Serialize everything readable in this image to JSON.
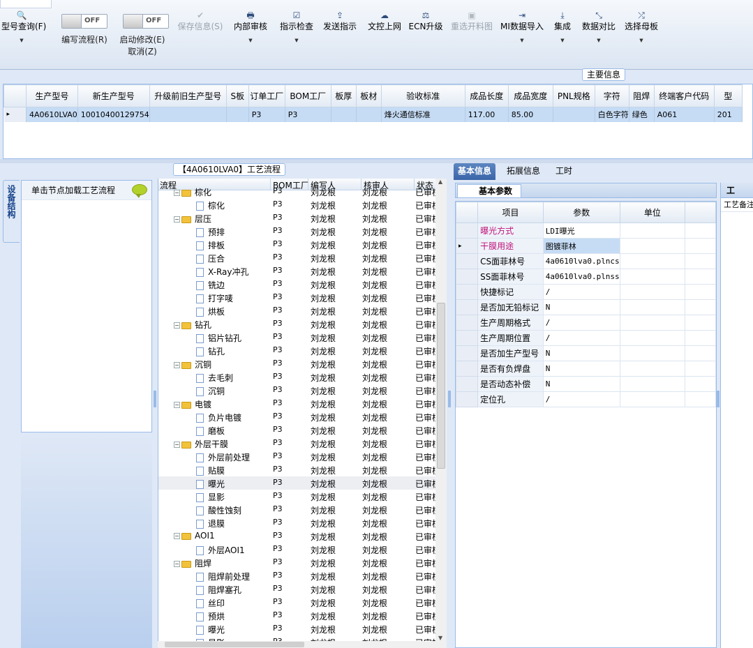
{
  "toolbar": {
    "items": [
      {
        "label": "型号查询(F)",
        "icon": "🔍",
        "dd": "▼",
        "disabled": false
      },
      {
        "label": "保存信息(S)",
        "icon": "✔",
        "dd": "",
        "disabled": true
      },
      {
        "label": "内部审核",
        "icon": "🖶",
        "dd": "▼",
        "disabled": false
      },
      {
        "label": "指示检查",
        "icon": "☑",
        "dd": "▼",
        "disabled": false
      },
      {
        "label": "发送指示",
        "icon": "⇪",
        "dd": "",
        "disabled": false
      },
      {
        "label": "文控上网",
        "icon": "☁",
        "dd": "",
        "disabled": false
      },
      {
        "label": "ECN升级",
        "icon": "⚖",
        "dd": "",
        "disabled": false
      },
      {
        "label": "重选开料图",
        "icon": "▣",
        "dd": "",
        "disabled": true
      },
      {
        "label": "MI数据导入",
        "icon": "⇥",
        "dd": "▼",
        "disabled": false
      },
      {
        "label": "集成",
        "icon": "⤓",
        "dd": "▼",
        "disabled": false
      },
      {
        "label": "数据对比",
        "icon": "⤡",
        "dd": "▼",
        "disabled": false
      },
      {
        "label": "选择母板",
        "icon": "⤮",
        "dd": "▼",
        "disabled": false
      }
    ],
    "toggle1": {
      "state": "OFF",
      "label": "编写流程(R)"
    },
    "toggle2": {
      "state": "OFF",
      "label": "启动修改(E)",
      "label2": "取消(Z)"
    }
  },
  "master": {
    "title": "主要信息",
    "columns": [
      "生产型号",
      "新生产型号",
      "升级前旧生产型号",
      "S板",
      "订单工厂",
      "BOM工厂",
      "板厚",
      "板材",
      "验收标准",
      "成品长度",
      "成品宽度",
      "PNL规格",
      "字符",
      "阻焊",
      "终端客户代码",
      "型"
    ],
    "row": [
      "4A0610LVA0",
      "10010400129754",
      "",
      "",
      "P3",
      "P3",
      "",
      "",
      "烽火通信标准",
      "117.00",
      "85.00",
      "",
      "白色字符",
      "绿色",
      "A061",
      "201"
    ]
  },
  "sidebar": {
    "label": "设备结构"
  },
  "left": {
    "hint": "单击节点加载工艺流程"
  },
  "flow": {
    "title": "【4A0610LVA0】工艺流程",
    "columns": [
      "流程",
      "BOM工厂",
      "编写人",
      "核审人",
      "状态"
    ],
    "rows": [
      {
        "name": "棕化",
        "type": "folder",
        "bom": "P3",
        "w": "刘龙根",
        "r": "刘龙根",
        "s": "已审核"
      },
      {
        "name": "棕化",
        "type": "file",
        "bom": "P3",
        "w": "刘龙根",
        "r": "刘龙根",
        "s": "已审核"
      },
      {
        "name": "层压",
        "type": "folder",
        "bom": "P3",
        "w": "刘龙根",
        "r": "刘龙根",
        "s": "已审核"
      },
      {
        "name": "预排",
        "type": "file",
        "bom": "P3",
        "w": "刘龙根",
        "r": "刘龙根",
        "s": "已审核"
      },
      {
        "name": "排板",
        "type": "file",
        "bom": "P3",
        "w": "刘龙根",
        "r": "刘龙根",
        "s": "已审核"
      },
      {
        "name": "压合",
        "type": "file",
        "bom": "P3",
        "w": "刘龙根",
        "r": "刘龙根",
        "s": "已审核"
      },
      {
        "name": "X-Ray冲孔",
        "type": "file",
        "bom": "P3",
        "w": "刘龙根",
        "r": "刘龙根",
        "s": "已审核"
      },
      {
        "name": "铣边",
        "type": "file",
        "bom": "P3",
        "w": "刘龙根",
        "r": "刘龙根",
        "s": "已审核"
      },
      {
        "name": "打字唛",
        "type": "file",
        "bom": "P3",
        "w": "刘龙根",
        "r": "刘龙根",
        "s": "已审核"
      },
      {
        "name": "烘板",
        "type": "file",
        "bom": "P3",
        "w": "刘龙根",
        "r": "刘龙根",
        "s": "已审核"
      },
      {
        "name": "钻孔",
        "type": "folder",
        "bom": "P3",
        "w": "刘龙根",
        "r": "刘龙根",
        "s": "已审核"
      },
      {
        "name": "铝片钻孔",
        "type": "file",
        "bom": "P3",
        "w": "刘龙根",
        "r": "刘龙根",
        "s": "已审核"
      },
      {
        "name": "钻孔",
        "type": "file",
        "bom": "P3",
        "w": "刘龙根",
        "r": "刘龙根",
        "s": "已审核"
      },
      {
        "name": "沉铜",
        "type": "folder",
        "bom": "P3",
        "w": "刘龙根",
        "r": "刘龙根",
        "s": "已审核"
      },
      {
        "name": "去毛刺",
        "type": "file",
        "bom": "P3",
        "w": "刘龙根",
        "r": "刘龙根",
        "s": "已审核"
      },
      {
        "name": "沉铜",
        "type": "file",
        "bom": "P3",
        "w": "刘龙根",
        "r": "刘龙根",
        "s": "已审核"
      },
      {
        "name": "电镀",
        "type": "folder",
        "bom": "P3",
        "w": "刘龙根",
        "r": "刘龙根",
        "s": "已审核"
      },
      {
        "name": "负片电镀",
        "type": "file",
        "bom": "P3",
        "w": "刘龙根",
        "r": "刘龙根",
        "s": "已审核"
      },
      {
        "name": "磨板",
        "type": "file",
        "bom": "P3",
        "w": "刘龙根",
        "r": "刘龙根",
        "s": "已审核"
      },
      {
        "name": "外层干膜",
        "type": "folder",
        "bom": "P3",
        "w": "刘龙根",
        "r": "刘龙根",
        "s": "已审核"
      },
      {
        "name": "外层前处理",
        "type": "file",
        "bom": "P3",
        "w": "刘龙根",
        "r": "刘龙根",
        "s": "已审核"
      },
      {
        "name": "贴膜",
        "type": "file",
        "bom": "P3",
        "w": "刘龙根",
        "r": "刘龙根",
        "s": "已审核"
      },
      {
        "name": "曝光",
        "type": "file",
        "bom": "P3",
        "w": "刘龙根",
        "r": "刘龙根",
        "s": "已审核",
        "sel": true
      },
      {
        "name": "显影",
        "type": "file",
        "bom": "P3",
        "w": "刘龙根",
        "r": "刘龙根",
        "s": "已审核"
      },
      {
        "name": "酸性蚀刻",
        "type": "file",
        "bom": "P3",
        "w": "刘龙根",
        "r": "刘龙根",
        "s": "已审核"
      },
      {
        "name": "退膜",
        "type": "file",
        "bom": "P3",
        "w": "刘龙根",
        "r": "刘龙根",
        "s": "已审核"
      },
      {
        "name": "AOI1",
        "type": "folder",
        "bom": "P3",
        "w": "刘龙根",
        "r": "刘龙根",
        "s": "已审核"
      },
      {
        "name": "外层AOI1",
        "type": "file",
        "bom": "P3",
        "w": "刘龙根",
        "r": "刘龙根",
        "s": "已审核"
      },
      {
        "name": "阻焊",
        "type": "folder",
        "bom": "P3",
        "w": "刘龙根",
        "r": "刘龙根",
        "s": "已审核"
      },
      {
        "name": "阻焊前处理",
        "type": "file",
        "bom": "P3",
        "w": "刘龙根",
        "r": "刘龙根",
        "s": "已审核"
      },
      {
        "name": "阻焊塞孔",
        "type": "file",
        "bom": "P3",
        "w": "刘龙根",
        "r": "刘龙根",
        "s": "已审核"
      },
      {
        "name": "丝印",
        "type": "file",
        "bom": "P3",
        "w": "刘龙根",
        "r": "刘龙根",
        "s": "已审核"
      },
      {
        "name": "预烘",
        "type": "file",
        "bom": "P3",
        "w": "刘龙根",
        "r": "刘龙根",
        "s": "已审核"
      },
      {
        "name": "曝光",
        "type": "file",
        "bom": "P3",
        "w": "刘龙根",
        "r": "刘龙根",
        "s": "已审核"
      },
      {
        "name": "显影",
        "type": "file",
        "bom": "P3",
        "w": "刘龙根",
        "r": "刘龙根",
        "s": "已审核"
      }
    ]
  },
  "tabs": {
    "items": [
      "基本信息",
      "拓展信息",
      "工时"
    ]
  },
  "params": {
    "title": "基本参数",
    "columns": [
      "项目",
      "参数",
      "单位"
    ],
    "rows": [
      {
        "item": "曝光方式",
        "value": "LDI曝光",
        "unit": "",
        "red": true
      },
      {
        "item": "干膜用途",
        "value": "图镀菲林",
        "unit": "",
        "red": true,
        "current": true
      },
      {
        "item": "CS面菲林号",
        "value": "4a0610lva0.plncs",
        "unit": ""
      },
      {
        "item": "SS面菲林号",
        "value": "4a0610lva0.plnss",
        "unit": ""
      },
      {
        "item": "快捷标记",
        "value": "/",
        "unit": ""
      },
      {
        "item": "是否加无铅标记",
        "value": "N",
        "unit": ""
      },
      {
        "item": "生产周期格式",
        "value": "/",
        "unit": ""
      },
      {
        "item": "生产周期位置",
        "value": "/",
        "unit": ""
      },
      {
        "item": "是否加生产型号",
        "value": "N",
        "unit": ""
      },
      {
        "item": "是否有负焊盘",
        "value": "N",
        "unit": ""
      },
      {
        "item": "是否动态补偿",
        "value": "N",
        "unit": ""
      },
      {
        "item": "定位孔",
        "value": "/",
        "unit": ""
      }
    ]
  },
  "rightpanel": {
    "title": "工",
    "sub": "工艺备注"
  }
}
